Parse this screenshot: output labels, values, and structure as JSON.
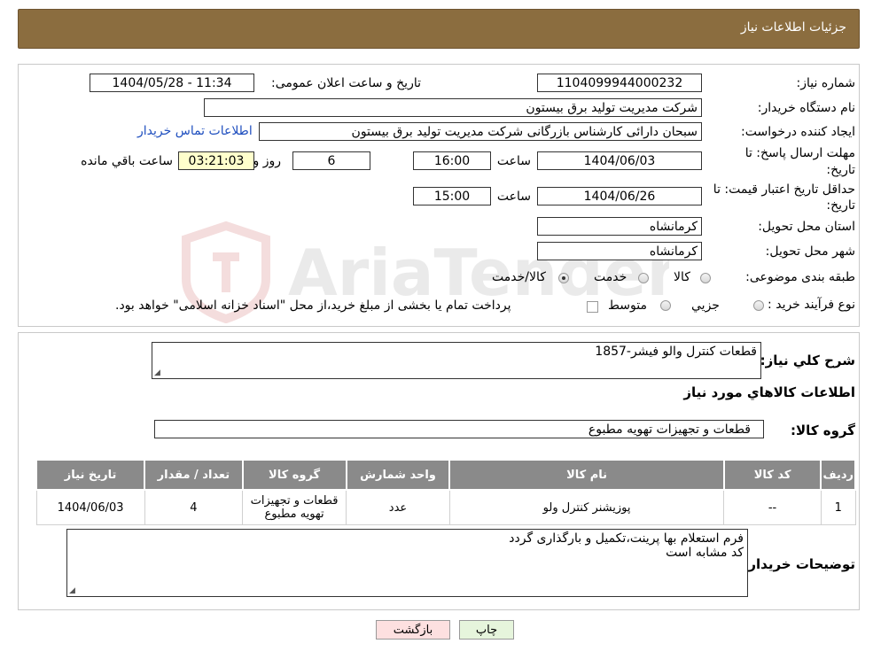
{
  "header": {
    "title": "جزئیات اطلاعات نیاز"
  },
  "details": {
    "need_number_label": "شماره نیاز:",
    "need_number": "1104099944000232",
    "announce_label": "تاریخ و ساعت اعلان عمومی:",
    "announce_value": "1404/05/28 - 11:34",
    "buyer_org_label": "نام دستگاه خریدار:",
    "buyer_org": "شرکت مدیریت تولید برق بیستون",
    "creator_label": "ایجاد کننده درخواست:",
    "creator": "سبحان دارائی کارشناس بازرگانی شرکت مدیریت تولید برق بیستون",
    "contact_link": "اطلاعات تماس خریدار",
    "deadline_label_1": "مهلت ارسال پاسخ: تا",
    "deadline_label_2": "تاریخ:",
    "deadline_date": "1404/06/03",
    "time_label": "ساعت",
    "deadline_time": "16:00",
    "days": "6",
    "days_label": "روز و",
    "remaining": "03:21:03",
    "remaining_label": "ساعت باقي مانده",
    "validity_label_1": "حداقل تاریخ اعتبار قیمت: تا",
    "validity_label_2": "تاریخ:",
    "validity_date": "1404/06/26",
    "validity_time": "15:00",
    "province_label": "استان محل تحویل:",
    "province": "کرمانشاه",
    "city_label": "شهر محل تحویل:",
    "city": "کرمانشاه",
    "category_label": "طبقه بندی موضوعی:",
    "category_options": [
      "کالا",
      "خدمت",
      "کالا/خدمت"
    ],
    "process_label": "نوع فرآیند خرید :",
    "process_options": [
      "جزیي",
      "متوسط"
    ],
    "process_note": "پرداخت تمام یا بخشی از مبلغ خرید،از محل \"اسناد خزانه اسلامی\" خواهد بود."
  },
  "summary": {
    "description_label": "شرح کلي نياز:",
    "description": "قطعات کنترل والو فیشر-1857",
    "goods_info_title": "اطلاعات کالاهاي مورد نياز",
    "group_label": "گروه کالا:",
    "group_value": "قطعات و تجهیزات تهویه مطبوع"
  },
  "table": {
    "headers": [
      "ردیف",
      "کد کالا",
      "نام کالا",
      "واحد شمارش",
      "گروه کالا",
      "تعداد / مقدار",
      "تاریخ نیاز"
    ],
    "rows": [
      [
        "1",
        "--",
        "پوزیشنر کنترل ولو",
        "عدد",
        "قطعات و تجهیزات تهویه مطبوع",
        "4",
        "1404/06/03"
      ]
    ]
  },
  "buyer_notes": {
    "label": "توضیحات خریدار:",
    "line1": "فرم استعلام بها پرینت،تکمیل و بارگذاری گردد",
    "line2": "کد مشابه است"
  },
  "buttons": {
    "print": "چاپ",
    "back": "بازگشت"
  },
  "colors": {
    "header": "#8b6d3f",
    "remaining_bg": "#ffffcc",
    "link": "#1f4fbf",
    "back_bg": "#fde0e0",
    "print_bg": "#e6f5dc"
  }
}
